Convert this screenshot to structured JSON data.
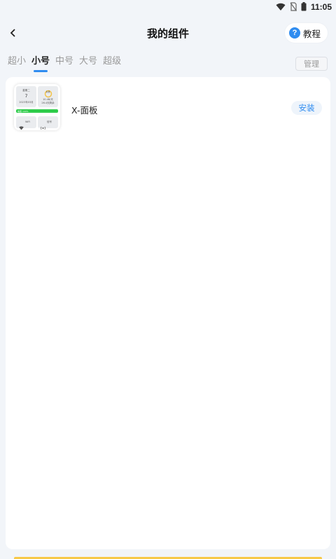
{
  "status_bar": {
    "time": "11:05"
  },
  "header": {
    "title": "我的组件",
    "tutorial_label": "教程",
    "tutorial_icon_glyph": "?"
  },
  "tabs": [
    {
      "label": "超小",
      "active": false
    },
    {
      "label": "小号",
      "active": true
    },
    {
      "label": "中号",
      "active": false
    },
    {
      "label": "大号",
      "active": false
    },
    {
      "label": "超级",
      "active": false
    }
  ],
  "manage_label": "管理",
  "widgets": [
    {
      "name": "X-面板",
      "install_label": "安装",
      "preview": {
        "day": "星期二",
        "date_num": "7",
        "date_full": "2023年03月",
        "ring_label": "总量",
        "usage_top": "10.4B/天",
        "usage_bottom": "26.4天剩余",
        "green_label": "电量 100%",
        "wifi_text": "WiFi",
        "signal_text": "信号"
      }
    }
  ],
  "colors": {
    "accent": "#2f8cf0",
    "green": "#2ecc4a",
    "background": "#f2f5f9"
  }
}
